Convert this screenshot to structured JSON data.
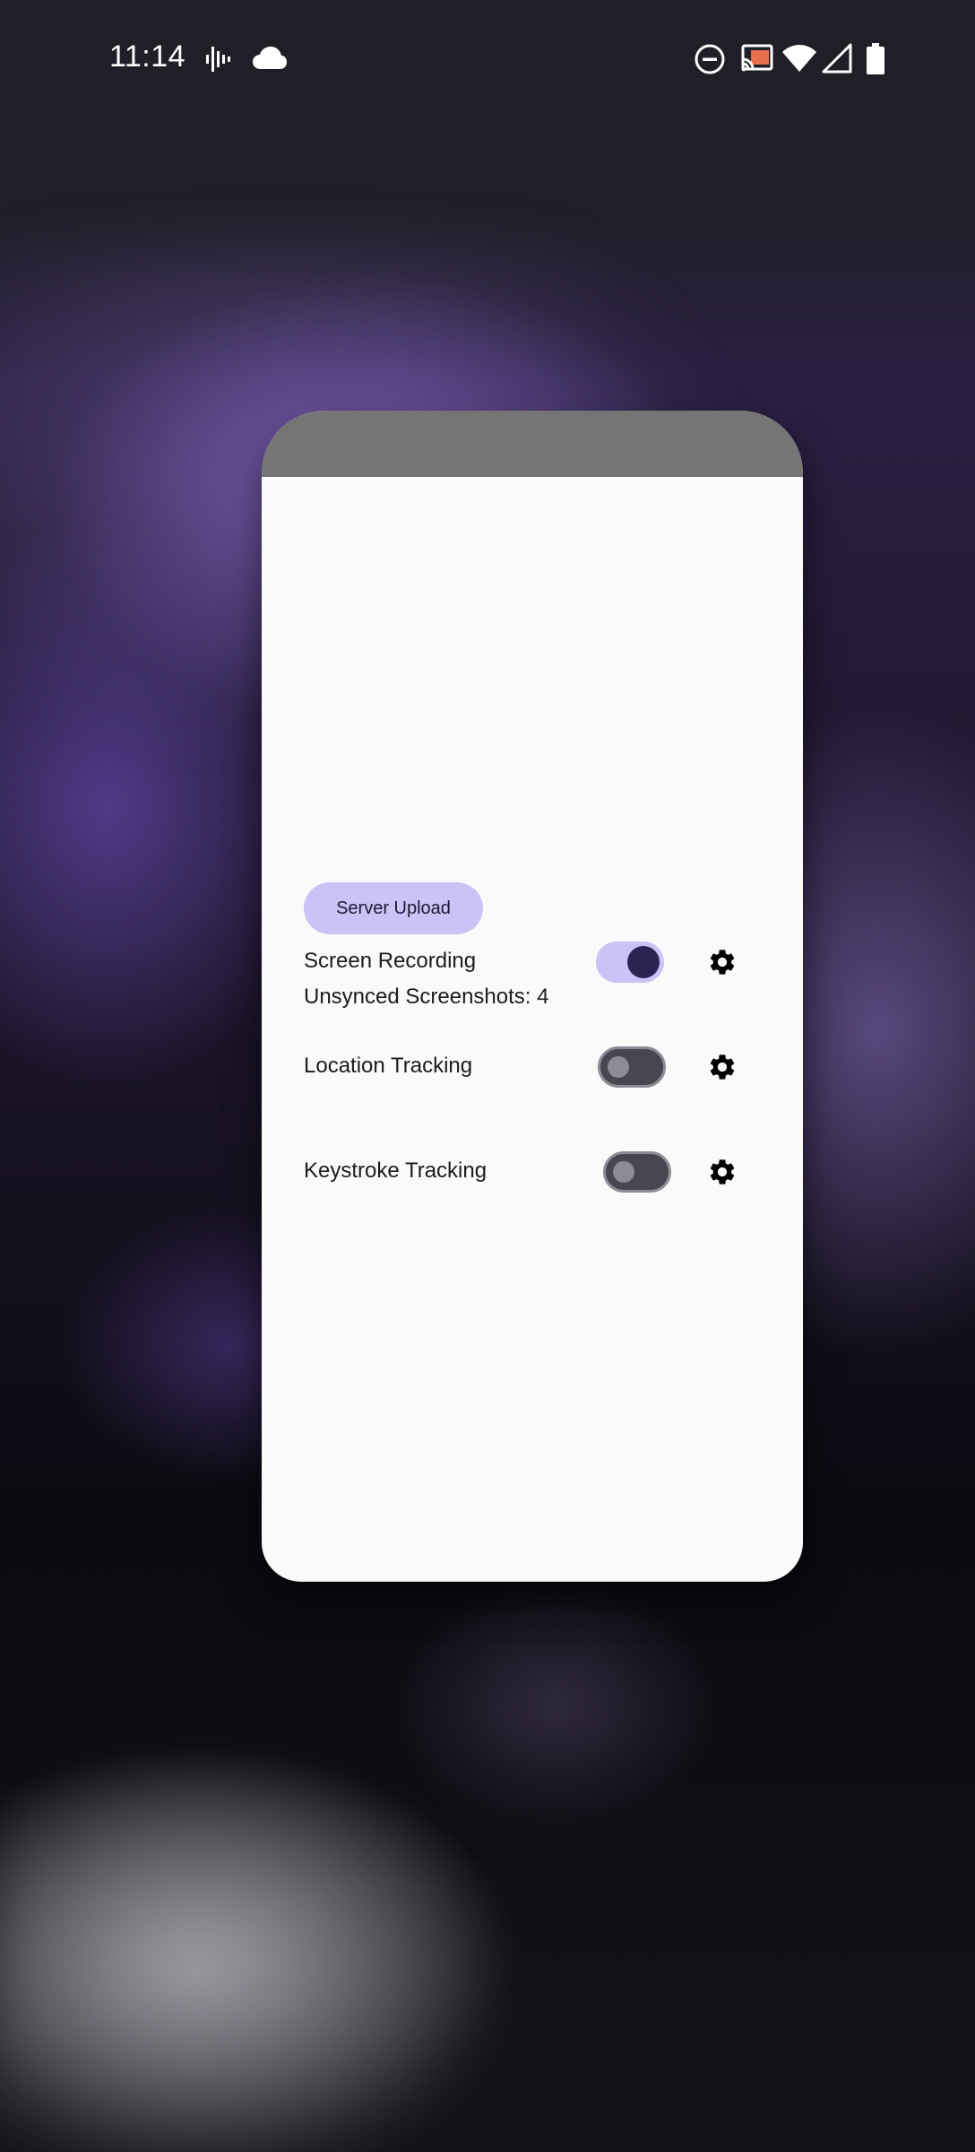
{
  "status_bar": {
    "time": "11:14",
    "icons": [
      "audio-waveform-icon",
      "cloud-icon",
      "do-not-disturb-icon",
      "cast-icon",
      "wifi-icon",
      "cellular-signal-icon",
      "battery-icon"
    ]
  },
  "card": {
    "header_color": "#757575",
    "rows": [
      {
        "label": "Screen Recording",
        "enabled": true,
        "settings_icon": "gear-icon"
      },
      {
        "label": "Location Tracking",
        "enabled": false,
        "settings_icon": "gear-icon"
      },
      {
        "label": "Keystroke Tracking",
        "enabled": false,
        "settings_icon": "gear-icon"
      }
    ],
    "upload_button": "Server Upload",
    "unsynced_text": "Unsynced Screenshots: 4"
  },
  "colors": {
    "accent": "#cbc2f6",
    "accent_dark": "#2b2452",
    "switch_off_track": "#48464f",
    "card_background": "#fafafa"
  }
}
